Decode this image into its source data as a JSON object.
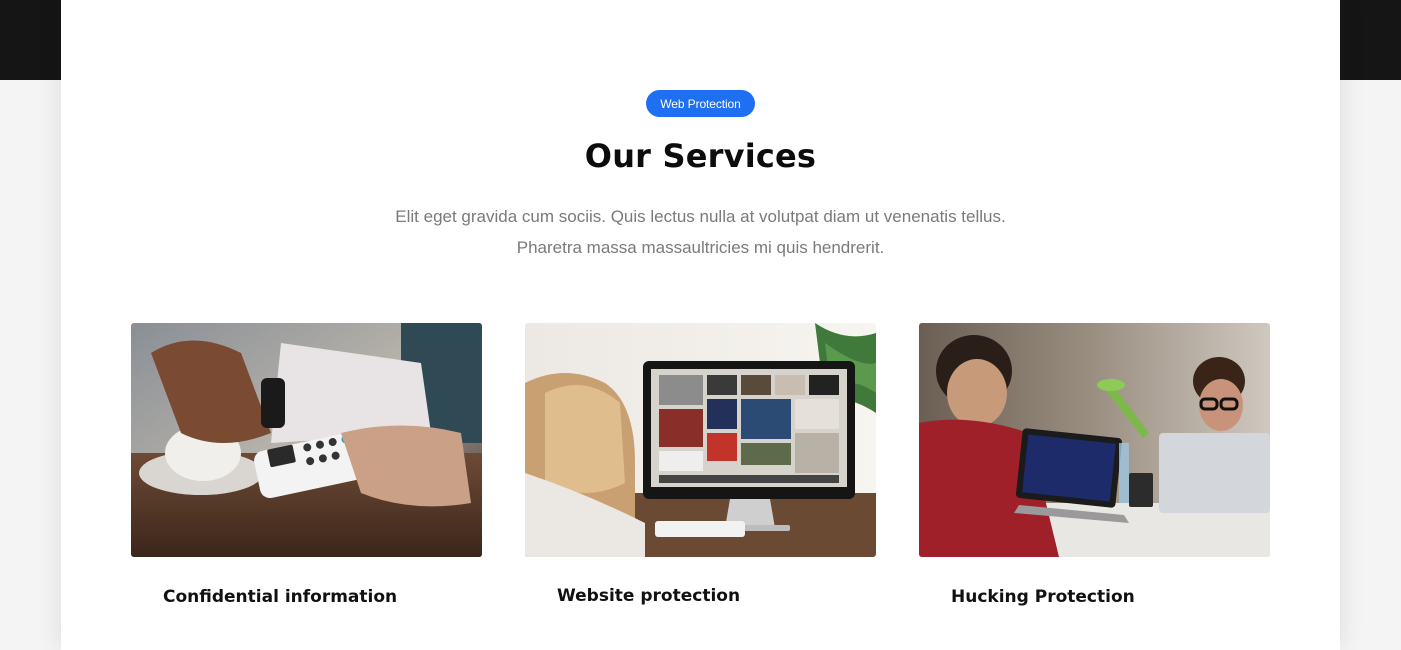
{
  "section": {
    "badge": "Web Protection",
    "title": "Our Services",
    "description_line1": "Elit eget gravida cum sociis. Quis lectus nulla at volutpat diam ut venenatis tellus.",
    "description_line2": "Pharetra massa massaultricies mi quis hendrerit."
  },
  "cards": [
    {
      "title": "Confidential information",
      "image": "card-payment-terminal-photo"
    },
    {
      "title": "Website protection",
      "image": "website-on-monitor-photo"
    },
    {
      "title": "Hucking Protection",
      "image": "developers-with-laptops-photo"
    }
  ],
  "colors": {
    "accent": "#1f6ff2",
    "heading": "#0c0c0c",
    "body_text": "#7a7a7a",
    "header_band": "#151515"
  }
}
